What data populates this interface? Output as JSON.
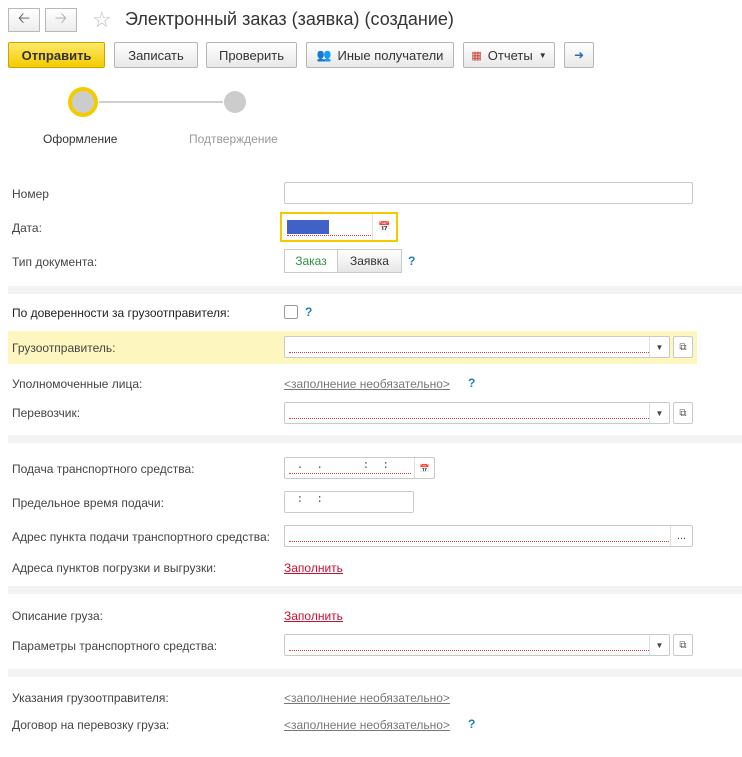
{
  "header": {
    "back_icon": "arrow-left-icon",
    "forward_icon": "arrow-right-icon",
    "favorite_icon": "star-icon",
    "title": "Электронный заказ (заявка) (создание)"
  },
  "toolbar": {
    "send": "Отправить",
    "save": "Записать",
    "check": "Проверить",
    "other_recipients": "Иные получатели",
    "reports": "Отчеты"
  },
  "steps": [
    {
      "label": "Оформление",
      "active": true
    },
    {
      "label": "Подтверждение",
      "active": false
    }
  ],
  "form": {
    "number_label": "Номер",
    "number_value": "",
    "date_label": "Дата:",
    "date_value": "  .  .    ",
    "doc_type_label": "Тип документа:",
    "doc_type_options": [
      "Заказ",
      "Заявка"
    ],
    "doc_type_selected": "Заказ",
    "help_mark": "?",
    "by_proxy_label": "По доверенности за грузоотправителя:",
    "shipper_label": "Грузоотправитель:",
    "authorized_label": "Уполномоченные лица:",
    "authorized_link": "<заполнение необязательно>",
    "carrier_label": "Перевозчик:",
    "vehicle_supply_label": "Подача транспортного средства:",
    "vehicle_supply_value": " .  .      :  :",
    "deadline_label": "Предельное время подачи:",
    "deadline_value": " :  :",
    "supply_address_label": "Адрес пункта подачи транспортного средства:",
    "supply_address_btn": "...",
    "load_points_label": "Адреса пунктов погрузки и выгрузки:",
    "fill_link": "Заполнить",
    "cargo_label": "Описание груза:",
    "vehicle_params_label": "Параметры транспортного средства:",
    "shipper_instructions_label": "Указания грузоотправителя:",
    "contract_label": "Договор на перевозку груза:",
    "optional_link": "<заполнение необязательно>"
  },
  "colors": {
    "accent_yellow": "#f3cc00",
    "highlight_row": "#fdf7bf",
    "link_red": "#c8102e",
    "help_blue": "#1c7fb5",
    "active_tab_green": "#2f8f46"
  }
}
